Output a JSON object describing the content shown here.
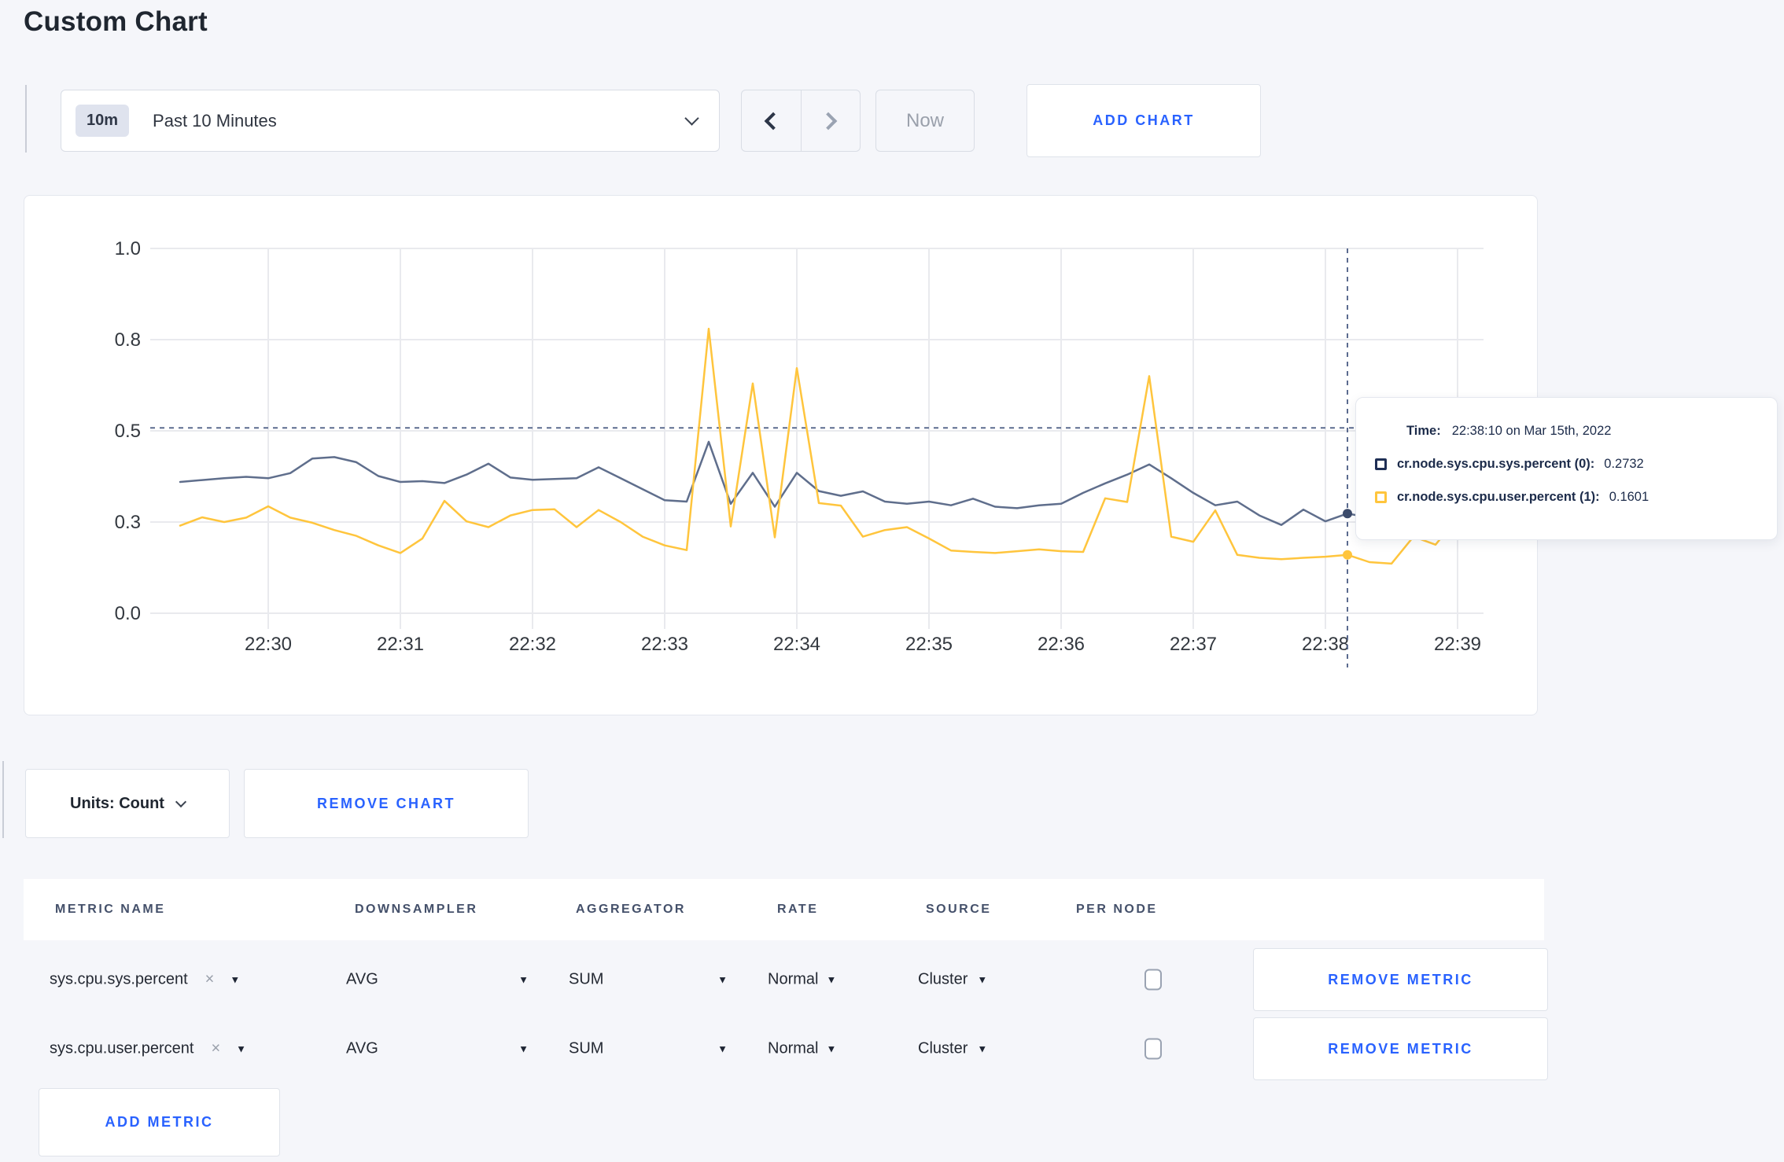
{
  "colors": {
    "accent": "#2962ff",
    "sys_line": "#5f6e8c",
    "user_line": "#ffc53d",
    "sys_legend": "#1f2f55",
    "user_legend": "#ffc53d",
    "crosshair": "#5b6b8f",
    "grid": "#e9eaee",
    "page_bg": "#f5f6fa"
  },
  "page": {
    "title": "Custom Chart"
  },
  "toolbar": {
    "range_badge": "10m",
    "range_label": "Past 10 Minutes",
    "now_label": "Now",
    "add_chart_label": "ADD CHART"
  },
  "chart_data": {
    "type": "line",
    "title": "",
    "xlabel": "",
    "ylabel": "",
    "ylim": [
      0,
      1
    ],
    "grid": true,
    "x_start": "22:29:20",
    "x_interval_seconds": 10,
    "x_ticks": [
      "22:30",
      "22:31",
      "22:32",
      "22:33",
      "22:34",
      "22:35",
      "22:36",
      "22:37",
      "22:38",
      "22:39"
    ],
    "y_ticks": [
      {
        "value": 0.0,
        "label": "0.0"
      },
      {
        "value": 0.25,
        "label": "0.3"
      },
      {
        "value": 0.5,
        "label": "0.5"
      },
      {
        "value": 0.75,
        "label": "0.8"
      },
      {
        "value": 1.0,
        "label": "1.0"
      }
    ],
    "series": [
      {
        "name": "cr.node.sys.cpu.sys.percent (0)",
        "color": "#5f6e8c",
        "values": [
          0.36,
          0.365,
          0.37,
          0.374,
          0.37,
          0.384,
          0.424,
          0.428,
          0.414,
          0.376,
          0.36,
          0.362,
          0.357,
          0.38,
          0.41,
          0.372,
          0.366,
          0.368,
          0.37,
          0.4,
          0.37,
          0.34,
          0.31,
          0.306,
          0.47,
          0.3,
          0.385,
          0.292,
          0.385,
          0.335,
          0.322,
          0.334,
          0.306,
          0.3,
          0.306,
          0.296,
          0.314,
          0.292,
          0.288,
          0.296,
          0.3,
          0.33,
          0.356,
          0.38,
          0.408,
          0.37,
          0.33,
          0.296,
          0.306,
          0.268,
          0.242,
          0.284,
          0.252,
          0.2732,
          0.262,
          0.268,
          0.272,
          0.264,
          0.27,
          0.272
        ]
      },
      {
        "name": "cr.node.sys.cpu.user.percent (1)",
        "color": "#ffc53d",
        "values": [
          0.24,
          0.263,
          0.25,
          0.262,
          0.293,
          0.262,
          0.248,
          0.228,
          0.212,
          0.186,
          0.165,
          0.205,
          0.308,
          0.252,
          0.236,
          0.268,
          0.283,
          0.285,
          0.236,
          0.283,
          0.25,
          0.21,
          0.186,
          0.173,
          0.78,
          0.238,
          0.63,
          0.208,
          0.672,
          0.302,
          0.295,
          0.21,
          0.228,
          0.236,
          0.205,
          0.172,
          0.168,
          0.165,
          0.17,
          0.175,
          0.17,
          0.168,
          0.315,
          0.305,
          0.65,
          0.21,
          0.196,
          0.282,
          0.16,
          0.152,
          0.148,
          0.152,
          0.155,
          0.1601,
          0.14,
          0.136,
          0.21,
          0.188,
          0.262,
          0.225
        ]
      }
    ],
    "crosshair": {
      "time": "22:38:10",
      "point_index": 53,
      "hline_value": 0.508
    }
  },
  "tooltip": {
    "time_label": "Time:",
    "time_value": "22:38:10 on Mar 15th, 2022",
    "series": [
      {
        "name": "cr.node.sys.cpu.sys.percent (0):",
        "value": "0.2732",
        "color": "#1f2f55"
      },
      {
        "name": "cr.node.sys.cpu.user.percent (1):",
        "value": "0.1601",
        "color": "#ffc53d"
      }
    ]
  },
  "chart_controls": {
    "units_label": "Units: Count",
    "remove_chart_label": "REMOVE CHART"
  },
  "metrics_table": {
    "headers": [
      "METRIC NAME",
      "DOWNSAMPLER",
      "AGGREGATOR",
      "RATE",
      "SOURCE",
      "PER NODE"
    ],
    "rows": [
      {
        "metric": "sys.cpu.sys.percent",
        "downsampler": "AVG",
        "aggregator": "SUM",
        "rate": "Normal",
        "source": "Cluster",
        "per_node_checked": false,
        "remove_label": "REMOVE METRIC"
      },
      {
        "metric": "sys.cpu.user.percent",
        "downsampler": "AVG",
        "aggregator": "SUM",
        "rate": "Normal",
        "source": "Cluster",
        "per_node_checked": false,
        "remove_label": "REMOVE METRIC"
      }
    ],
    "add_metric_label": "ADD METRIC"
  }
}
